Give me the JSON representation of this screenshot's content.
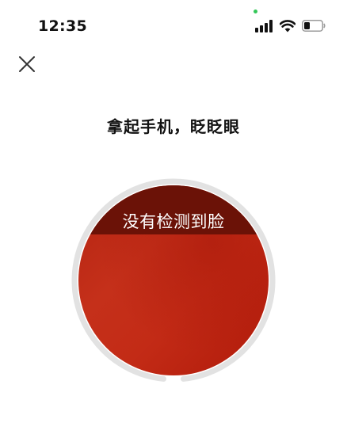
{
  "status_bar": {
    "time": "12:35",
    "icons": [
      "signal-icon",
      "wifi-icon",
      "battery-icon"
    ],
    "battery_level": 0.35,
    "mic_indicator_color": "#34c759"
  },
  "nav": {
    "close_icon": "close-icon"
  },
  "instruction": {
    "title": "拿起手机，眨眨眼"
  },
  "camera": {
    "status_message": "没有检测到脸",
    "ring_color": "#e2e2e2",
    "banner_color": "#6b1207",
    "preview_color": "#c32b16"
  }
}
